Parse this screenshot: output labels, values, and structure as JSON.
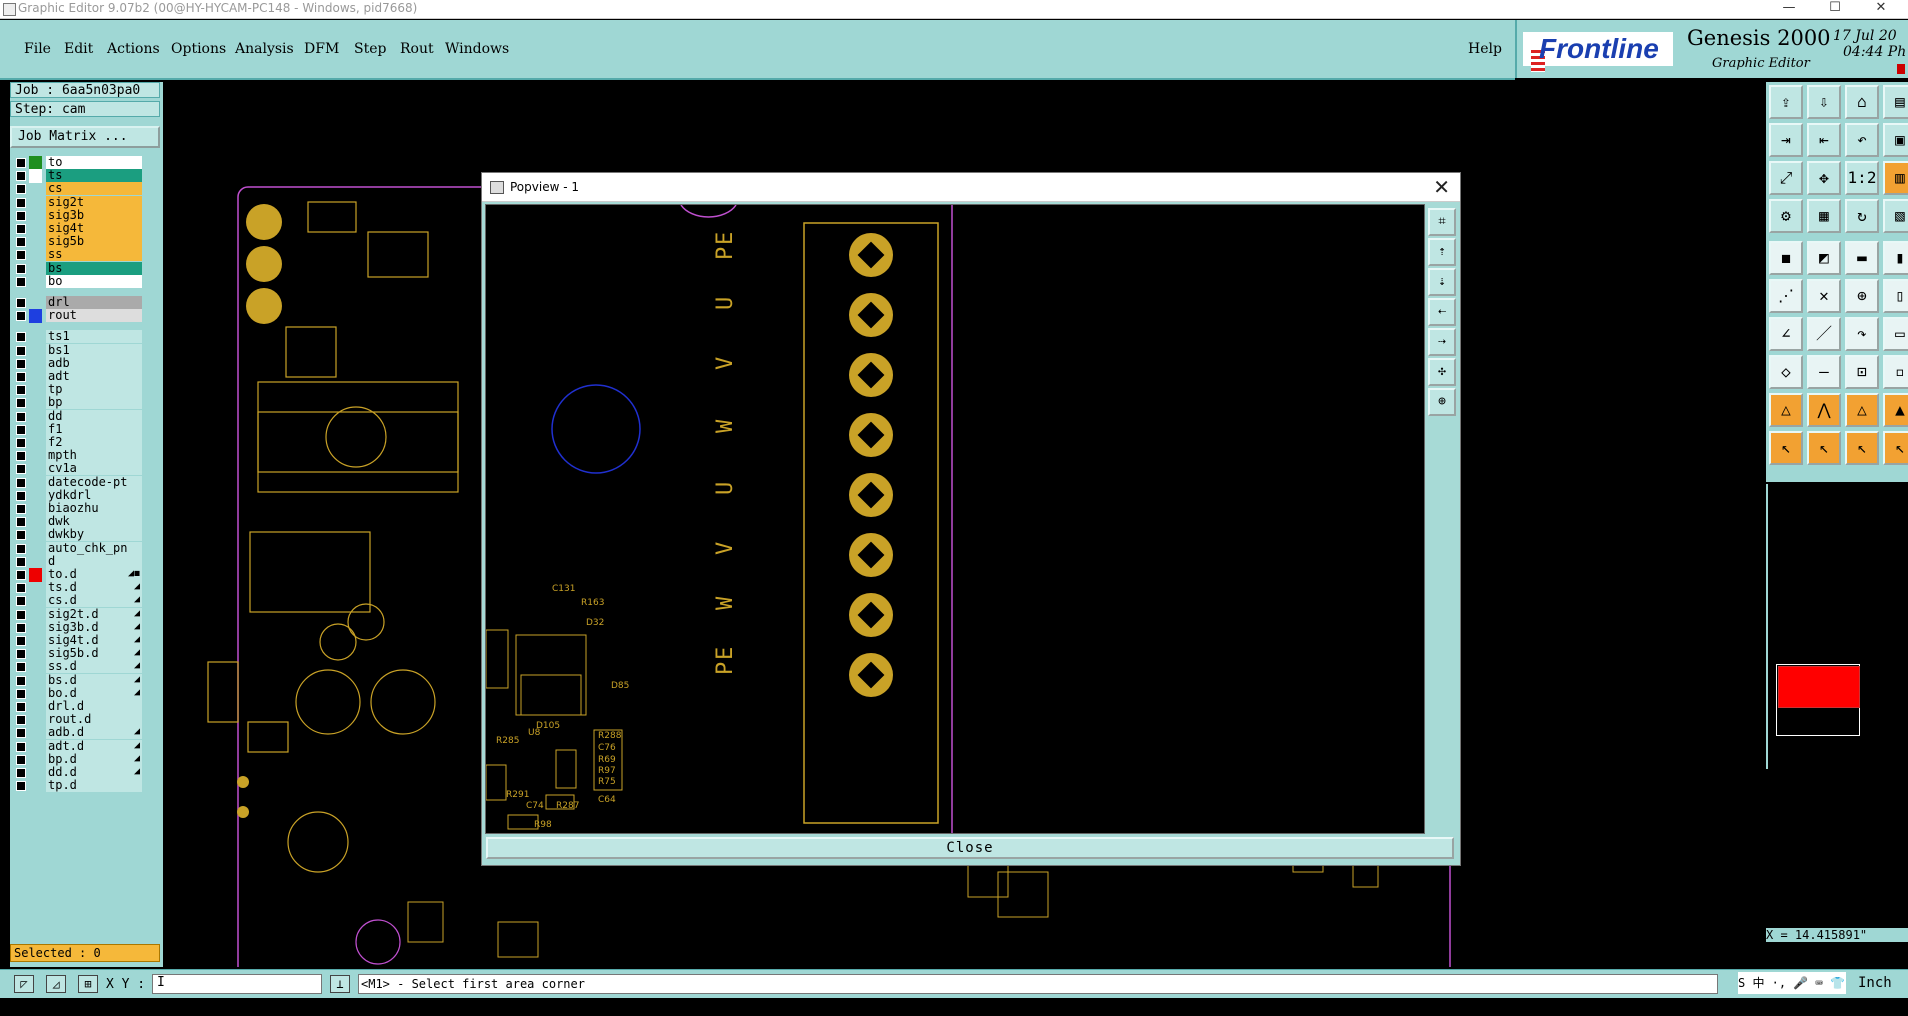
{
  "window": {
    "title": "Graphic Editor 9.07b2 (00@HY-HYCAM-PC148 - Windows, pid7668)",
    "minimize": "—",
    "maximize": "☐",
    "close": "✕"
  },
  "menu": {
    "items": [
      "File",
      "Edit",
      "Actions",
      "Options",
      "Analysis",
      "DFM",
      "Step",
      "Rout",
      "Windows"
    ],
    "help": "Help"
  },
  "brand": {
    "logo": "Frontline",
    "product": "Genesis 2000",
    "subtitle": "Graphic Editor",
    "date": "17 Jul 20",
    "time": "04:44 Ph"
  },
  "job": {
    "job": "Job :  6aa5n03pa0",
    "step": "Step: cam",
    "matrix_button": "Job Matrix ..."
  },
  "layers": [
    {
      "name": "to",
      "color": "#fff",
      "swatch": "#1f8f1f"
    },
    {
      "name": "ts",
      "color": "#1b9e80",
      "swatch": "#fff"
    },
    {
      "name": "cs",
      "color": "#f5b83a",
      "swatch": ""
    },
    {
      "name": "sig2t",
      "color": "#f5b83a",
      "swatch": ""
    },
    {
      "name": "sig3b",
      "color": "#f5b83a",
      "swatch": ""
    },
    {
      "name": "sig4t",
      "color": "#f5b83a",
      "swatch": ""
    },
    {
      "name": "sig5b",
      "color": "#f5b83a",
      "swatch": ""
    },
    {
      "name": "ss",
      "color": "#f5b83a",
      "swatch": ""
    },
    {
      "name": "bs",
      "color": "#1b9e80",
      "swatch": ""
    },
    {
      "name": "bo",
      "color": "#fff",
      "swatch": ""
    },
    {
      "name": "drl",
      "color": "#aaa",
      "swatch": ""
    },
    {
      "name": "rout",
      "color": "#ddd",
      "swatch": "#1e3fe0"
    },
    {
      "name": "ts1",
      "color": "#bfe6e3",
      "swatch": ""
    },
    {
      "name": "bs1",
      "color": "#bfe6e3",
      "swatch": ""
    },
    {
      "name": "adb",
      "color": "#bfe6e3",
      "swatch": ""
    },
    {
      "name": "adt",
      "color": "#bfe6e3",
      "swatch": ""
    },
    {
      "name": "tp",
      "color": "#bfe6e3",
      "swatch": ""
    },
    {
      "name": "bp",
      "color": "#bfe6e3",
      "swatch": ""
    },
    {
      "name": "dd",
      "color": "#bfe6e3",
      "swatch": ""
    },
    {
      "name": "f1",
      "color": "#bfe6e3",
      "swatch": ""
    },
    {
      "name": "f2",
      "color": "#bfe6e3",
      "swatch": ""
    },
    {
      "name": "mpth",
      "color": "#bfe6e3",
      "swatch": ""
    },
    {
      "name": "cv1a",
      "color": "#bfe6e3",
      "swatch": ""
    },
    {
      "name": "datecode-pt",
      "color": "#bfe6e3",
      "swatch": ""
    },
    {
      "name": "ydkdrl",
      "color": "#bfe6e3",
      "swatch": ""
    },
    {
      "name": "biaozhu",
      "color": "#bfe6e3",
      "swatch": ""
    },
    {
      "name": "dwk",
      "color": "#bfe6e3",
      "swatch": ""
    },
    {
      "name": "dwkby",
      "color": "#bfe6e3",
      "swatch": ""
    },
    {
      "name": "auto_chk_pn",
      "color": "#bfe6e3",
      "swatch": ""
    },
    {
      "name": "d",
      "color": "#bfe6e3",
      "swatch": ""
    },
    {
      "name": "to.d",
      "color": "#bfe6e3",
      "swatch": "#e00",
      "arrow": "◢◼"
    },
    {
      "name": "ts.d",
      "color": "#bfe6e3",
      "swatch": "",
      "arrow": "◢"
    },
    {
      "name": "cs.d",
      "color": "#bfe6e3",
      "swatch": "",
      "arrow": "◢"
    },
    {
      "name": "sig2t.d",
      "color": "#bfe6e3",
      "swatch": "",
      "arrow": "◢"
    },
    {
      "name": "sig3b.d",
      "color": "#bfe6e3",
      "swatch": "",
      "arrow": "◢"
    },
    {
      "name": "sig4t.d",
      "color": "#bfe6e3",
      "swatch": "",
      "arrow": "◢"
    },
    {
      "name": "sig5b.d",
      "color": "#bfe6e3",
      "swatch": "",
      "arrow": "◢"
    },
    {
      "name": "ss.d",
      "color": "#bfe6e3",
      "swatch": "",
      "arrow": "◢"
    },
    {
      "name": "bs.d",
      "color": "#bfe6e3",
      "swatch": "",
      "arrow": "◢"
    },
    {
      "name": "bo.d",
      "color": "#bfe6e3",
      "swatch": "",
      "arrow": "◢"
    },
    {
      "name": "drl.d",
      "color": "#bfe6e3",
      "swatch": ""
    },
    {
      "name": "rout.d",
      "color": "#bfe6e3",
      "swatch": ""
    },
    {
      "name": "adb.d",
      "color": "#bfe6e3",
      "swatch": "",
      "arrow": "◢"
    },
    {
      "name": "adt.d",
      "color": "#bfe6e3",
      "swatch": "",
      "arrow": "◢"
    },
    {
      "name": "bp.d",
      "color": "#bfe6e3",
      "swatch": "",
      "arrow": "◢"
    },
    {
      "name": "dd.d",
      "color": "#bfe6e3",
      "swatch": "",
      "arrow": "◢"
    },
    {
      "name": "tp.d",
      "color": "#bfe6e3",
      "swatch": ""
    }
  ],
  "selected": "Selected : 0",
  "popview": {
    "title": "Popview - 1",
    "close_button": "Close",
    "close_x": "✕",
    "terminal_left": [
      "P",
      "E",
      "W",
      "V",
      "U",
      "W",
      "V",
      "U",
      "P",
      "E"
    ],
    "terminal_top": [
      "P",
      "E",
      "U",
      "V",
      "W",
      "U",
      "V",
      "W",
      "P",
      "E"
    ]
  },
  "bottom": {
    "xy_label": "X Y :",
    "xy_value": "I",
    "prompt": "<M1> - Select first area corner",
    "unit": "Inch",
    "tray": "S 中 ·, 🎤 ⌨ 👕 ⊞"
  },
  "coord": "X = 14.415891\""
}
